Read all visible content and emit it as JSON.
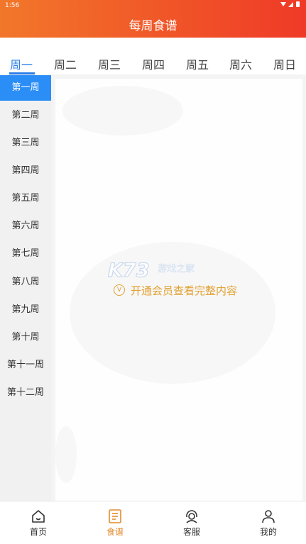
{
  "status_bar": {
    "time": "1:56"
  },
  "header": {
    "title": "每周食谱"
  },
  "day_tabs": [
    "周一",
    "周二",
    "周三",
    "周四",
    "周五",
    "周六",
    "周日"
  ],
  "active_day_index": 0,
  "weeks": [
    "第一周",
    "第二周",
    "第三周",
    "第四周",
    "第五周",
    "第六周",
    "第七周",
    "第八周",
    "第九周",
    "第十周",
    "第十一周",
    "第十二周"
  ],
  "active_week_index": 0,
  "content": {
    "watermark_logo": "K73",
    "watermark_text": "游戏之家",
    "unlock_icon": "vip-icon",
    "unlock_text": "开通会员查看完整内容"
  },
  "bottom_nav": [
    {
      "label": "首页",
      "icon": "home-icon"
    },
    {
      "label": "食谱",
      "icon": "recipe-icon"
    },
    {
      "label": "客服",
      "icon": "customer-service-icon"
    },
    {
      "label": "我的",
      "icon": "user-icon"
    }
  ],
  "active_nav_index": 1,
  "colors": {
    "header_start": "#f2772a",
    "header_end": "#ef3a27",
    "accent_blue": "#2b7de9",
    "active_week_bg": "#2b8ef7",
    "nav_active": "#e68a2b",
    "unlock_text": "#e2a132"
  }
}
